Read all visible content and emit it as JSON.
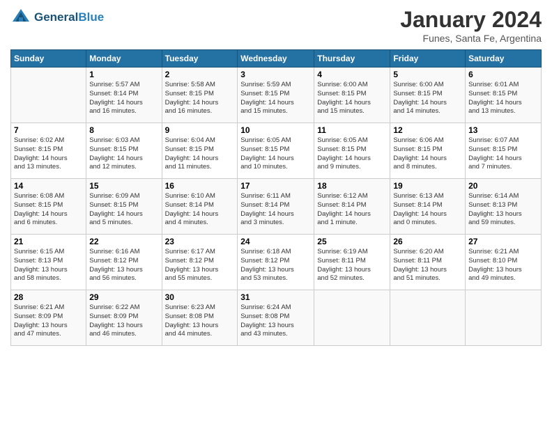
{
  "header": {
    "logo_line1": "General",
    "logo_line2": "Blue",
    "month": "January 2024",
    "location": "Funes, Santa Fe, Argentina"
  },
  "days_of_week": [
    "Sunday",
    "Monday",
    "Tuesday",
    "Wednesday",
    "Thursday",
    "Friday",
    "Saturday"
  ],
  "weeks": [
    [
      {
        "num": "",
        "info": ""
      },
      {
        "num": "1",
        "info": "Sunrise: 5:57 AM\nSunset: 8:14 PM\nDaylight: 14 hours\nand 16 minutes."
      },
      {
        "num": "2",
        "info": "Sunrise: 5:58 AM\nSunset: 8:15 PM\nDaylight: 14 hours\nand 16 minutes."
      },
      {
        "num": "3",
        "info": "Sunrise: 5:59 AM\nSunset: 8:15 PM\nDaylight: 14 hours\nand 15 minutes."
      },
      {
        "num": "4",
        "info": "Sunrise: 6:00 AM\nSunset: 8:15 PM\nDaylight: 14 hours\nand 15 minutes."
      },
      {
        "num": "5",
        "info": "Sunrise: 6:00 AM\nSunset: 8:15 PM\nDaylight: 14 hours\nand 14 minutes."
      },
      {
        "num": "6",
        "info": "Sunrise: 6:01 AM\nSunset: 8:15 PM\nDaylight: 14 hours\nand 13 minutes."
      }
    ],
    [
      {
        "num": "7",
        "info": "Sunrise: 6:02 AM\nSunset: 8:15 PM\nDaylight: 14 hours\nand 13 minutes."
      },
      {
        "num": "8",
        "info": "Sunrise: 6:03 AM\nSunset: 8:15 PM\nDaylight: 14 hours\nand 12 minutes."
      },
      {
        "num": "9",
        "info": "Sunrise: 6:04 AM\nSunset: 8:15 PM\nDaylight: 14 hours\nand 11 minutes."
      },
      {
        "num": "10",
        "info": "Sunrise: 6:05 AM\nSunset: 8:15 PM\nDaylight: 14 hours\nand 10 minutes."
      },
      {
        "num": "11",
        "info": "Sunrise: 6:05 AM\nSunset: 8:15 PM\nDaylight: 14 hours\nand 9 minutes."
      },
      {
        "num": "12",
        "info": "Sunrise: 6:06 AM\nSunset: 8:15 PM\nDaylight: 14 hours\nand 8 minutes."
      },
      {
        "num": "13",
        "info": "Sunrise: 6:07 AM\nSunset: 8:15 PM\nDaylight: 14 hours\nand 7 minutes."
      }
    ],
    [
      {
        "num": "14",
        "info": "Sunrise: 6:08 AM\nSunset: 8:15 PM\nDaylight: 14 hours\nand 6 minutes."
      },
      {
        "num": "15",
        "info": "Sunrise: 6:09 AM\nSunset: 8:15 PM\nDaylight: 14 hours\nand 5 minutes."
      },
      {
        "num": "16",
        "info": "Sunrise: 6:10 AM\nSunset: 8:14 PM\nDaylight: 14 hours\nand 4 minutes."
      },
      {
        "num": "17",
        "info": "Sunrise: 6:11 AM\nSunset: 8:14 PM\nDaylight: 14 hours\nand 3 minutes."
      },
      {
        "num": "18",
        "info": "Sunrise: 6:12 AM\nSunset: 8:14 PM\nDaylight: 14 hours\nand 1 minute."
      },
      {
        "num": "19",
        "info": "Sunrise: 6:13 AM\nSunset: 8:14 PM\nDaylight: 14 hours\nand 0 minutes."
      },
      {
        "num": "20",
        "info": "Sunrise: 6:14 AM\nSunset: 8:13 PM\nDaylight: 13 hours\nand 59 minutes."
      }
    ],
    [
      {
        "num": "21",
        "info": "Sunrise: 6:15 AM\nSunset: 8:13 PM\nDaylight: 13 hours\nand 58 minutes."
      },
      {
        "num": "22",
        "info": "Sunrise: 6:16 AM\nSunset: 8:12 PM\nDaylight: 13 hours\nand 56 minutes."
      },
      {
        "num": "23",
        "info": "Sunrise: 6:17 AM\nSunset: 8:12 PM\nDaylight: 13 hours\nand 55 minutes."
      },
      {
        "num": "24",
        "info": "Sunrise: 6:18 AM\nSunset: 8:12 PM\nDaylight: 13 hours\nand 53 minutes."
      },
      {
        "num": "25",
        "info": "Sunrise: 6:19 AM\nSunset: 8:11 PM\nDaylight: 13 hours\nand 52 minutes."
      },
      {
        "num": "26",
        "info": "Sunrise: 6:20 AM\nSunset: 8:11 PM\nDaylight: 13 hours\nand 51 minutes."
      },
      {
        "num": "27",
        "info": "Sunrise: 6:21 AM\nSunset: 8:10 PM\nDaylight: 13 hours\nand 49 minutes."
      }
    ],
    [
      {
        "num": "28",
        "info": "Sunrise: 6:21 AM\nSunset: 8:09 PM\nDaylight: 13 hours\nand 47 minutes."
      },
      {
        "num": "29",
        "info": "Sunrise: 6:22 AM\nSunset: 8:09 PM\nDaylight: 13 hours\nand 46 minutes."
      },
      {
        "num": "30",
        "info": "Sunrise: 6:23 AM\nSunset: 8:08 PM\nDaylight: 13 hours\nand 44 minutes."
      },
      {
        "num": "31",
        "info": "Sunrise: 6:24 AM\nSunset: 8:08 PM\nDaylight: 13 hours\nand 43 minutes."
      },
      {
        "num": "",
        "info": ""
      },
      {
        "num": "",
        "info": ""
      },
      {
        "num": "",
        "info": ""
      }
    ]
  ]
}
